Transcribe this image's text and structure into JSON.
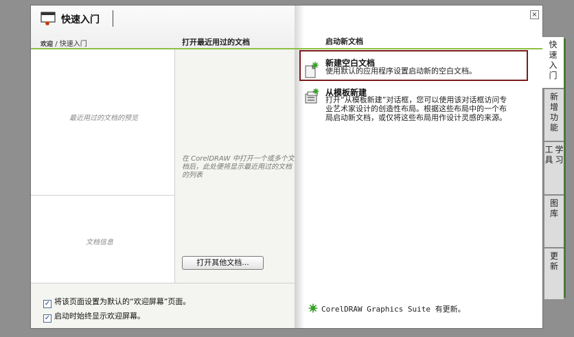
{
  "window": {
    "title": "快速入门",
    "close_label": "×"
  },
  "breadcrumb": {
    "welcome": "欢迎",
    "separator": " / ",
    "current": "快速入门"
  },
  "columns": {
    "recent_header": "打开最近用过的文档",
    "new_header": "启动新文档"
  },
  "left_panel": {
    "preview_note": "最近用过的文档的预览",
    "docinfo_note": "文档信息"
  },
  "recent_panel": {
    "note": "在 CorelDRAW 中打开一个或多个文档后，此处便将显示最近用过的文档的列表",
    "open_other_label": "打开其他文档..."
  },
  "new_doc": {
    "options": [
      {
        "title": "新建空白文档",
        "description": "使用默认的应用程序设置启动新的空白文档。",
        "icon": "new-blank-document-icon"
      },
      {
        "title": "从模板新建",
        "description": "打开“从模板新建”对话框，您可以使用该对话框访问专业艺术家设计的创造性布局。根据这些布局中的一个布局启动新文档，或仅将这些布局用作设计灵感的来源。",
        "icon": "new-from-template-icon"
      }
    ],
    "update_text": "CorelDRAW Graphics Suite 有更新。"
  },
  "footer": {
    "checkbox_default": {
      "label": "将该页面设置为默认的“欢迎屏幕”页面。",
      "checked": true
    },
    "checkbox_always": {
      "label": "启动时始终显示欢迎屏幕。",
      "checked": true
    }
  },
  "tabs": [
    {
      "label": "快速入门",
      "active": true
    },
    {
      "label": "新增功能",
      "active": false
    },
    {
      "label": "学习工具",
      "active": false
    },
    {
      "label": "图库",
      "active": false
    },
    {
      "label": "更新",
      "active": false
    }
  ],
  "colors": {
    "accent_green": "#8cc043",
    "highlight_border": "#7a1a1a",
    "desktop": "#8f8f8f"
  }
}
